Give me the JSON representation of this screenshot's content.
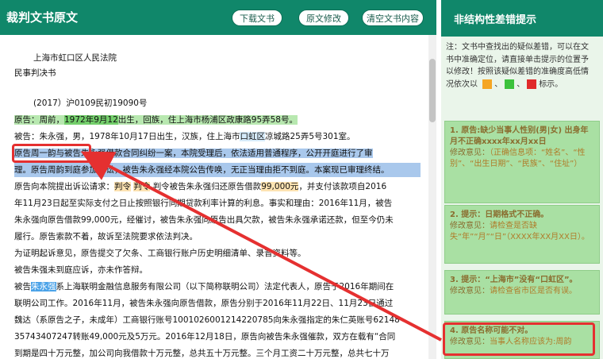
{
  "editor": {
    "title": "裁判文书原文",
    "buttons": {
      "download": "下载文书",
      "original": "原文修改",
      "clear": "清空文书内容"
    }
  },
  "document": {
    "l1": "上海市虹口区人民法院",
    "l2": "民事判决书",
    "l3": "(2017）沪0109民初19090号",
    "l4a": "原告：周前，",
    "l4b": "1972年9月12",
    "l4c": "出生，回族，住上海市杨浦区政康路95弄58号。",
    "l5a": "被告：朱永强，男，1978年10月17日出生，汉族，住上海市",
    "l5b": "口虹区",
    "l5c": "凉城路25弄5号301室。",
    "l6a": "原",
    "l6b": "告周一韵与被告朱永强借款合同纠纷一案，本院受理后，依法适用普通程序，公开开庭进行了审",
    "l7": "理。原告周韵到庭参加诉讼，被告朱永强经本院公告传唤，无正当理由拒不到庭。本案现已审理终结。",
    "l8a": "原告向本院提出诉讼请求：",
    "l8b": "判令",
    "l8c": "判令",
    "l8d": "判令被告朱永强归还原告借款",
    "l8e": "99,000元",
    "l8f": "，并支付该款项自2016",
    "l9": "年11月23日起至实际支付之日止按照银行同期贷款利率计算的利息。事实和理由：2016年11月，被告",
    "l10": "朱永强向原告借款99,000元，经催讨，被告朱永强向原告出具欠款，被告朱永强承诺还款，但至今仍未",
    "l11": "履行。原告索款不着，故诉至法院要求依法判决。",
    "l12": "为证明起诉意见，原告提交了欠条、工商银行账户历史明细清单、录音资料等。",
    "l13": "被告朱强未到庭应诉，亦未作答辩。",
    "l14a": "被告",
    "l14b": "朱永强",
    "l14c": "系上海联明金融信息服务有限公司（以下简称联明公司）法定代表人，原告于2016年期间在",
    "l15": "联明公司工作。2016年11月，被告朱永强向原告借款，原告分别于2016年11月22日、11月23日通过",
    "l16": "魏达（系原告之子，未成年）工商银行账号1001026001214220785向朱永强指定的朱仁英账号62148",
    "l17": "35743407247转账49,000元及5万元。2016年12月18日，原告向被告朱永强催款，双方在载有“合同",
    "l18": "到期是四十万元整，加公司向我借款十万元整，总共五十万元整。三个月工资二十万元整，总共七十万"
  },
  "sidebar": {
    "title": "非结构性差错提示",
    "note_a": "注：文书中查找出的疑似差错，可以在文书中准确定位，请直接单击提示的位置予以修改！按照该疑似差错的准确度高低情况依次以",
    "note_b": "、",
    "note_c": "、",
    "note_d": "标示。",
    "swatches": [
      "#f5a623",
      "#3cc23c",
      "#e02a2a"
    ],
    "cards": [
      {
        "title": "1. 原告:缺少当事人性别(男|女) 出身年月不正确xxxx年xx月xx日",
        "label": "修改意见：",
        "tips": "（正确信息项：“姓名”、“性别”、“出生日期”、“民族”、“住址”）"
      },
      {
        "title": "2. 提示：日期格式不正确。",
        "label": "修改意见：",
        "tips": "请检查是否缺失“年”“月”“日”（XXXX年XX月XX日）。"
      },
      {
        "title": "3. 提示：“上海市”没有“口虹区”。",
        "label": "修改意见：",
        "tips": "请检查省市区是否有误。"
      },
      {
        "title": "4. 原告名称可能不对。",
        "label": "修改意见：",
        "tips": "当事人名称应该为:周韵"
      }
    ]
  }
}
